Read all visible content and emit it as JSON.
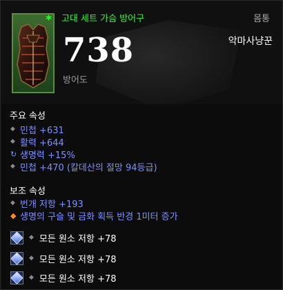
{
  "item": {
    "name": "고대 세트 가슴 방어구",
    "slot": "몸통",
    "class": "악마사냥꾼",
    "armor_value": "738",
    "armor_label": "방어도",
    "ancient_marker": "*"
  },
  "primary": {
    "title": "주요 속성",
    "attributes": [
      {
        "text": "민첩 +631",
        "bullet": "diamond"
      },
      {
        "text": "활력 +644",
        "bullet": "diamond"
      },
      {
        "text": "생명력 +15%",
        "bullet": "swirl"
      },
      {
        "text": "민첩 +470 (칼데산의 절망 94등급)",
        "bullet": "diamond"
      }
    ]
  },
  "secondary": {
    "title": "보조 속성",
    "attributes": [
      {
        "text": "번개 저항 +193",
        "bullet": "diamond"
      },
      {
        "text": "생명의 구슬 및 금화 획득 반경 1미터 증가",
        "bullet": "orange-diamond"
      }
    ]
  },
  "sockets": [
    {
      "gem": "diamond-gem-icon",
      "text": "모든 원소 저항 +78"
    },
    {
      "gem": "diamond-gem-icon",
      "text": "모든 원소 저항 +78"
    },
    {
      "gem": "diamond-gem-icon",
      "text": "모든 원소 저항 +78"
    }
  ],
  "colors": {
    "set_name": "#3df03d",
    "magic_attribute": "#7e90ff",
    "white_text": "#ffffff",
    "frame_green": "#2a5522"
  }
}
